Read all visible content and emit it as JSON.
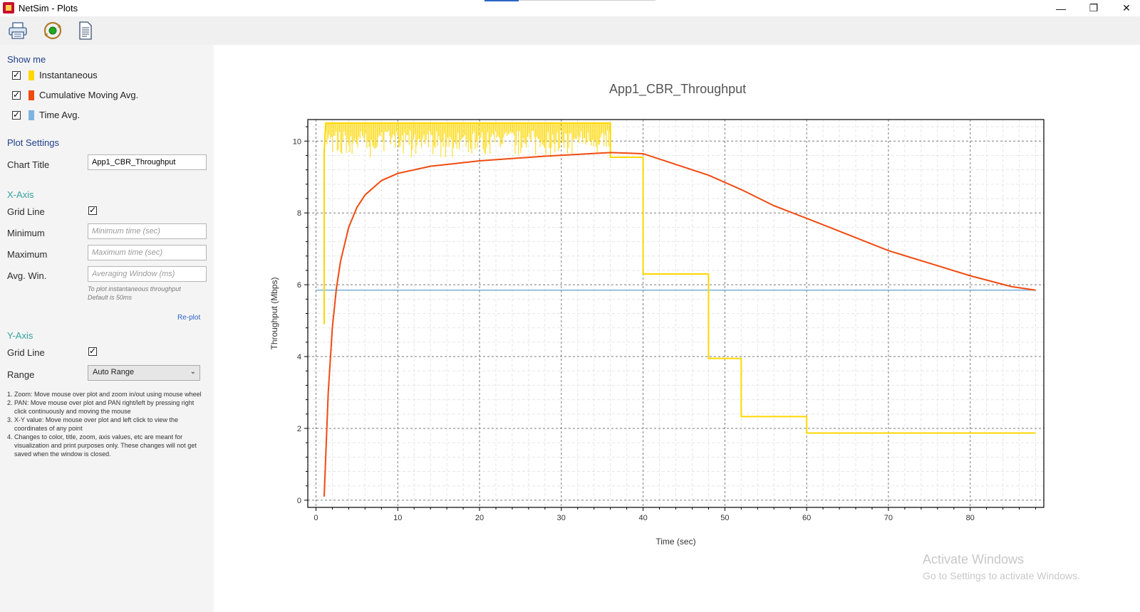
{
  "window": {
    "title": "NetSim - Plots",
    "minimize": "—",
    "restore": "❐",
    "close": "✕"
  },
  "toolbar": {
    "icons": [
      "print-icon",
      "refresh-icon",
      "document-icon"
    ]
  },
  "sidebar": {
    "show_me_heading": "Show me",
    "legend": [
      {
        "label": "Instantaneous",
        "color": "#ffd700",
        "checked": true
      },
      {
        "label": "Cumulative Moving Avg.",
        "color": "#f04a10",
        "checked": true
      },
      {
        "label": "Time Avg.",
        "color": "#7fb3e0",
        "checked": true
      }
    ],
    "plot_settings_heading": "Plot Settings",
    "chart_title_label": "Chart Title",
    "chart_title_value": "App1_CBR_Throughput",
    "x_axis_heading": "X-Axis",
    "x_grid_label": "Grid Line",
    "minimum_label": "Minimum",
    "minimum_placeholder": "Minimum time (sec)",
    "maximum_label": "Maximum",
    "maximum_placeholder": "Maximum time (sec)",
    "avg_win_label": "Avg. Win.",
    "avg_win_placeholder": "Averaging Window (ms)",
    "hint_line1": "To plot instantaneous throughput",
    "hint_line2": "Default is 50ms",
    "replot_label": "Re-plot",
    "y_axis_heading": "Y-Axis",
    "y_grid_label": "Grid Line",
    "range_label": "Range",
    "range_value": "Auto Range",
    "notes": [
      "1. Zoom: Move mouse over plot and zoom in/out using mouse wheel",
      "2. PAN: Move mouse over plot and PAN right/left by pressing right click continuously and moving the mouse",
      "3. X-Y value: Move mouse over plot and left click to view the coordinates of any point",
      "4. Changes to color, title, zoom, axis values, etc are meant for visualization and print purposes only. These changes will not get saved when the window is closed."
    ]
  },
  "chart_data": {
    "type": "line",
    "title": "App1_CBR_Throughput",
    "xlabel": "Time (sec)",
    "ylabel": "Throughput (Mbps)",
    "xlim": [
      -1,
      89
    ],
    "ylim": [
      -0.2,
      10.6
    ],
    "xticks": [
      0,
      10,
      20,
      30,
      40,
      50,
      60,
      70,
      80
    ],
    "yticks": [
      0,
      2,
      4,
      6,
      8,
      10
    ],
    "grid": true,
    "series": [
      {
        "name": "Instantaneous",
        "color": "#ffd700",
        "points": [
          [
            1,
            4.9
          ],
          [
            1,
            9.7
          ],
          [
            1.2,
            10.5
          ],
          [
            36,
            10.5
          ],
          [
            36,
            9.55
          ],
          [
            40,
            9.55
          ],
          [
            40,
            6.3
          ],
          [
            48,
            6.3
          ],
          [
            48,
            3.95
          ],
          [
            52,
            3.95
          ],
          [
            52,
            2.33
          ],
          [
            60,
            2.33
          ],
          [
            60,
            1.87
          ],
          [
            88,
            1.87
          ]
        ],
        "noise_band": [
          1.2,
          36,
          9.6,
          10.5
        ]
      },
      {
        "name": "Cumulative Moving Avg.",
        "color": "#f04a10",
        "points": [
          [
            1,
            0.1
          ],
          [
            1.5,
            3.0
          ],
          [
            2,
            4.8
          ],
          [
            2.5,
            5.9
          ],
          [
            3,
            6.65
          ],
          [
            4,
            7.6
          ],
          [
            5,
            8.15
          ],
          [
            6,
            8.5
          ],
          [
            8,
            8.9
          ],
          [
            10,
            9.1
          ],
          [
            14,
            9.3
          ],
          [
            20,
            9.45
          ],
          [
            28,
            9.58
          ],
          [
            36,
            9.68
          ],
          [
            40,
            9.65
          ],
          [
            44,
            9.35
          ],
          [
            48,
            9.05
          ],
          [
            52,
            8.65
          ],
          [
            56,
            8.2
          ],
          [
            60,
            7.85
          ],
          [
            65,
            7.4
          ],
          [
            70,
            6.95
          ],
          [
            75,
            6.6
          ],
          [
            80,
            6.25
          ],
          [
            85,
            5.95
          ],
          [
            88,
            5.85
          ]
        ]
      },
      {
        "name": "Time Avg.",
        "color": "#7fb3e0",
        "points": [
          [
            0,
            5.85
          ],
          [
            88,
            5.85
          ]
        ]
      }
    ]
  },
  "watermark": {
    "line1": "Activate Windows",
    "line2": "Go to Settings to activate Windows."
  }
}
